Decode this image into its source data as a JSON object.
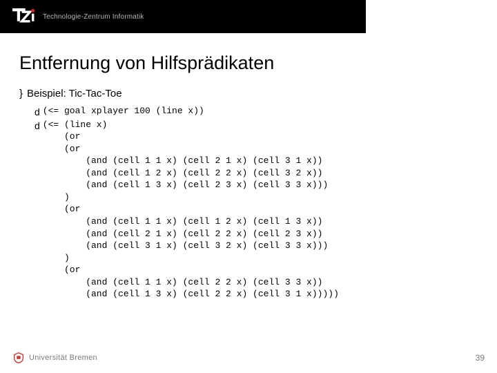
{
  "header": {
    "logo_label": "Technologie-Zentrum Informatik"
  },
  "title": "Entfernung von Hilfsprädikaten",
  "bullet_glyph": "}",
  "link_glyph": "d",
  "example_label": "Beispiel: Tic-Tac-Toe",
  "code_line1": "(<= goal xplayer 100 (line x))",
  "code_block2": "(<= (line x)\n    (or\n    (or\n        (and (cell 1 1 x) (cell 2 1 x) (cell 3 1 x))\n        (and (cell 1 2 x) (cell 2 2 x) (cell 3 2 x))\n        (and (cell 1 3 x) (cell 2 3 x) (cell 3 3 x)))\n    )\n    (or\n        (and (cell 1 1 x) (cell 1 2 x) (cell 1 3 x))\n        (and (cell 2 1 x) (cell 2 2 x) (cell 2 3 x))\n        (and (cell 3 1 x) (cell 3 2 x) (cell 3 3 x)))\n    )\n    (or\n        (and (cell 1 1 x) (cell 2 2 x) (cell 3 3 x))\n        (and (cell 1 3 x) (cell 2 2 x) (cell 3 1 x)))))",
  "footer": {
    "university": "Universität Bremen",
    "page": "39"
  }
}
